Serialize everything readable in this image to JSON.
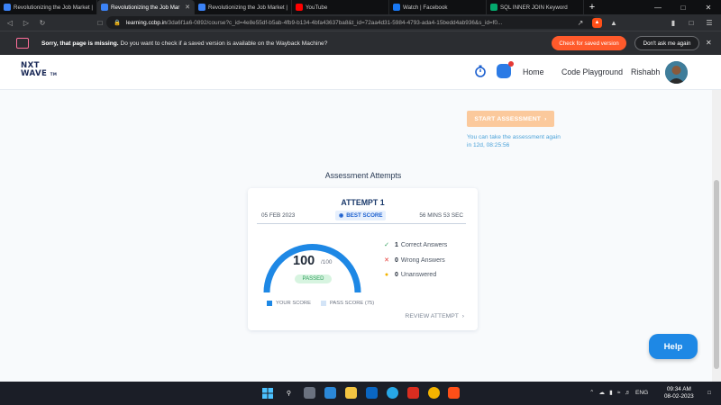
{
  "browser": {
    "tabs": [
      {
        "title": "Revolutionizing the Job Market |",
        "active": false,
        "favicon_color": "#3b82f6"
      },
      {
        "title": "Revolutionizing the Job Mar",
        "active": true,
        "favicon_color": "#3b82f6"
      },
      {
        "title": "Revolutionizing the Job Market |",
        "active": false,
        "favicon_color": "#3b82f6"
      },
      {
        "title": "YouTube",
        "active": false,
        "favicon_color": "#ff0000"
      },
      {
        "title": "Watch | Facebook",
        "active": false,
        "favicon_color": "#1877f2"
      },
      {
        "title": "SQL INNER JOIN Keyword",
        "active": false,
        "favicon_color": "#04aa6d"
      }
    ],
    "url_host": "learning.ccbp.in",
    "url_path": "/3da6f1a6-0892/course?c_id=4e8e55df-b5ab-4fb9-b134-4bfa43637ba8&t_id=72aa4d31-5984-4793-ada4-15bedd4ab936&s_id=f0..."
  },
  "wayback": {
    "bold_text": "Sorry, that page is missing.",
    "text": "Do you want to check if a saved version is available on the Wayback Machine?",
    "check_label": "Check for saved version",
    "dont_label": "Don't ask me again"
  },
  "header": {
    "logo_line1": "NXT",
    "logo_line2": "WAVE",
    "logo_tm": "TM",
    "nav_home": "Home",
    "nav_playground": "Code Playground",
    "user_name": "Rishabh"
  },
  "main": {
    "start_button": "START ASSESSMENT",
    "retake_note": "You can take the assessment again in 12d, 08:25:56",
    "attempts_title": "Assessment Attempts"
  },
  "attempt": {
    "label": "ATTEMPT 1",
    "date": "05 FEB 2023",
    "best_score": "BEST SCORE",
    "duration": "56 MINS 53 SEC",
    "score": "100",
    "score_max": "/100",
    "score_fraction": 1.0,
    "status": "PASSED",
    "correct_count": "1",
    "correct_label": "Correct Answers",
    "wrong_count": "0",
    "wrong_label": "Wrong Answers",
    "unanswered_count": "0",
    "unanswered_label": "Unanswered",
    "legend_your": "YOUR SCORE",
    "legend_pass": "PASS SCORE (75)",
    "review": "REVIEW ATTEMPT"
  },
  "help_label": "Help",
  "taskbar": {
    "lang": "ENG",
    "time": "09:34 AM",
    "date": "08-02-2023"
  },
  "colors": {
    "accent_blue": "#1e88e5",
    "start_button": "#fbc99c",
    "correct": "#2e9e5b",
    "wrong": "#e53935",
    "unanswered": "#f4b400"
  }
}
